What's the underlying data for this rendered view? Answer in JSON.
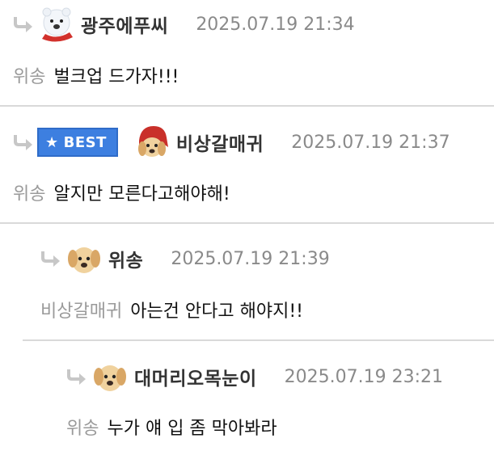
{
  "comments": [
    {
      "nickname": "광주에푸씨",
      "date": "2025.07.19 21:34",
      "mention": "위송",
      "text": "벌크업 드가자!!!",
      "avatar": "polar-bear-avatar"
    },
    {
      "badge": "BEST",
      "nickname": "비상갈매귀",
      "date": "2025.07.19 21:37",
      "mention": "위송",
      "text": "알지만 모른다고해야해!",
      "avatar": "puppy-red-hood-avatar"
    },
    {
      "nickname": "위송",
      "date": "2025.07.19 21:39",
      "mention": "비상갈매귀",
      "text": "아는건 안다고 해야지!!",
      "avatar": "puppy-avatar"
    },
    {
      "nickname": "대머리오목눈이",
      "date": "2025.07.19 23:21",
      "mention": "위송",
      "text": "누가 얘 입 좀 막아봐라",
      "avatar": "puppy-avatar"
    }
  ],
  "colors": {
    "nickname": "#333333",
    "date": "#8a8a8a",
    "mention": "#9a9a9a",
    "best_badge": "#3d7fe0",
    "divider": "#d9d9d9"
  }
}
